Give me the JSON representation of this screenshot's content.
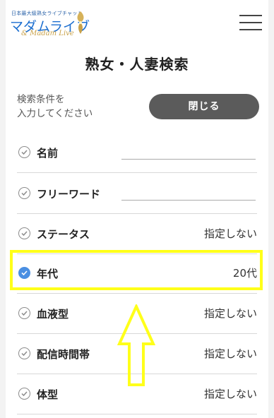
{
  "header": {
    "logo_small": "日本最大級熟女ライブチャット",
    "logo_main": "マダムライブ",
    "logo_sub": "& Madam Live",
    "menu_icon": "hamburger-icon"
  },
  "page_title": "熟女・人妻検索",
  "hint_line1": "検索条件を",
  "hint_line2": "入力してください",
  "close_button": "閉じる",
  "filters": [
    {
      "label": "名前",
      "value": "",
      "type": "text",
      "checked": false
    },
    {
      "label": "フリーワード",
      "value": "",
      "type": "text",
      "checked": false
    },
    {
      "label": "ステータス",
      "value": "指定しない",
      "type": "select",
      "checked": false
    },
    {
      "label": "年代",
      "value": "20代",
      "type": "select",
      "checked": true
    },
    {
      "label": "血液型",
      "value": "指定しない",
      "type": "select",
      "checked": false
    },
    {
      "label": "配信時間帯",
      "value": "指定しない",
      "type": "select",
      "checked": false
    },
    {
      "label": "体型",
      "value": "指定しない",
      "type": "select",
      "checked": false
    }
  ],
  "colors": {
    "accent": "#4a8fe2",
    "highlight": "#ffff1a",
    "button_bg": "#5b5b5b"
  }
}
